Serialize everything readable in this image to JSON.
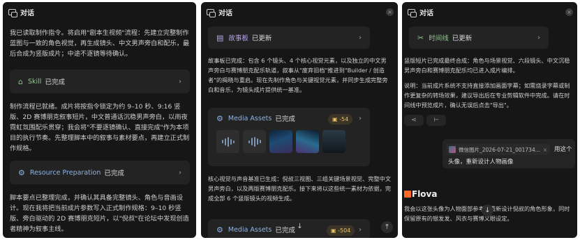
{
  "panel1": {
    "title": "对话",
    "para1": "我已读取制作指令。将启用\"剧本生视频\"流程：先建立完整制作蓝图与一致的角色视觉，再生成镜头、中文男声旁白和配乐，最后合成为竖版成片；中途不逐镜等待确认。",
    "skill_card": {
      "label": "Skill",
      "status": "已完成"
    },
    "para2": "制作流程已就绪。成片将按指令锁定为约 9–10 秒、9:16 竖版、2D 赛博朋克叙事短片，中文普通话沉稳男声旁白，以雨夜霓虹氛围配乐贯穿；我会将\"不要逐镜确认、直接完成\"作为本项目的执行节奏。先整理脚本中的叙事与素材要点，再建立正式制作规格。",
    "resource_card": {
      "label": "Resource Preparation",
      "status": "已完成"
    },
    "para3": "脚本要点已整理完成，并确认其具备完整镜头、角色与音画设计。现在我将把当前成片参数写入正式制作规格：9–10 秒竖版、旁白驱动的 2D 赛博朋克短片，以\"倪叔\"在论坛中发现创造者精神为叙事主线。"
  },
  "panel2": {
    "title": "对话",
    "storyboard_card": {
      "label": "故事板",
      "status": "已更新"
    },
    "para1": "故事板已完成：包含 6 个镜头、4 个核心视觉元素，以及独立的中文男声旁白与赛博朋克配乐轨道，叙事从\"废弃旧档\"推进到\"Builder / 创造者\"的揭晓与重启。现在先制作角色与关键视觉元素，并同步生成完整旁白和音乐，为镜头成片提供统一基准。",
    "media1": {
      "label": "Media Assets",
      "status": "已完成",
      "cost": "-54"
    },
    "para2": "核心视觉与声音基准已生成：倪叔三视图、三组关键场景视觉、完整中文男声旁白，以及两版赛博朋克配乐。接下来将以这些统一素材为依据，完成全部 6 个竖版镜头的视频生成。",
    "media2": {
      "label": "Media Assets",
      "status": "已完成",
      "cost": "-504"
    }
  },
  "panel3": {
    "title": "对话",
    "timeline_card": {
      "label": "时间线",
      "status": "已更新"
    },
    "para1": "竖版短片已完成最终合成：角色与场景视觉、六段镜头、中文沉稳男声旁白和赛博朋克配乐均已进入成片编排。",
    "para2": "说明：当前成片系统不支持直接添加画面字幕；如需烧录字幕或制作更复杂的转场效果，建议导出后在专业剪辑软件中完成。请在时间线中预览成片，确认无误后点击\"导出\"。",
    "image_chip": "微信图片_2026-07-21_001734...",
    "user_msg1": "用这个",
    "user_msg2": "头像，重新设计人物画像",
    "brand": "Flova",
    "reply": "我会以这张头像为人物面部参考，重新设计倪叔的角色形象，同时保留原有的银发发、风衣与赛博义眼设定。"
  },
  "colors": {
    "panel_bg": "#161616",
    "card_bg": "#232323",
    "skill_green": "#8fc98a",
    "resource_blue": "#8fb3e6",
    "storyboard_purple": "#b7a5e8",
    "cost_gold": "#e2c26a",
    "brand_orange": "#ff6a2a"
  }
}
